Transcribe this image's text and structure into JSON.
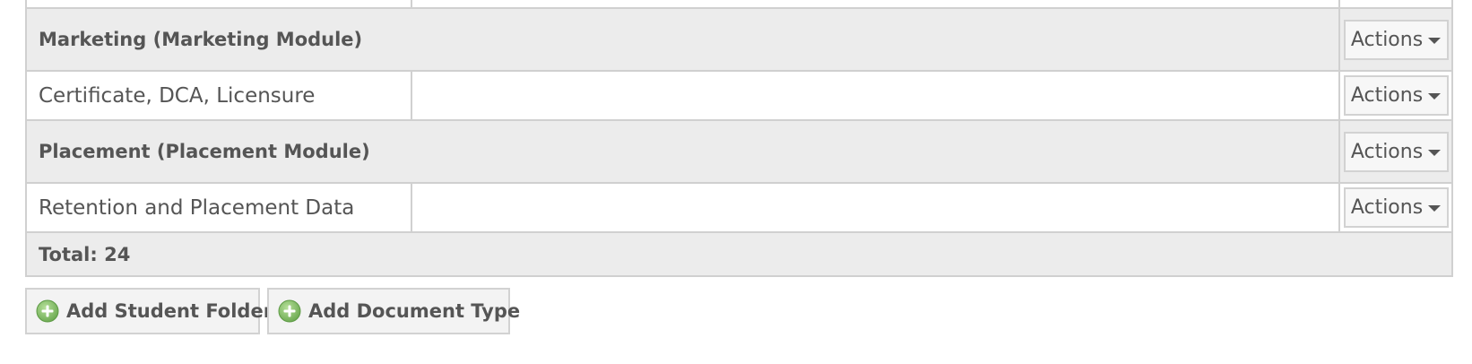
{
  "table": {
    "rows": [
      {
        "type": "group",
        "label": "Marketing (Marketing Module)",
        "action_label": "Actions"
      },
      {
        "type": "item",
        "label": "Certificate, DCA, Licensure",
        "description": "",
        "action_label": "Actions"
      },
      {
        "type": "group",
        "label": "Placement (Placement Module)",
        "action_label": "Actions"
      },
      {
        "type": "item",
        "label": "Retention and Placement Data",
        "description": "",
        "action_label": "Actions"
      }
    ],
    "total_label": "Total: 24"
  },
  "buttons": {
    "add_student_folder": "Add Student Folder",
    "add_document_type": "Add Document Type"
  },
  "icons": {
    "actions_caret": "caret-down-icon",
    "add": "plus-circle-icon"
  },
  "colors": {
    "group_row_bg": "#ececec",
    "border": "#d0d0d0",
    "text": "#555555",
    "add_icon_green": "#7dbb5c"
  }
}
